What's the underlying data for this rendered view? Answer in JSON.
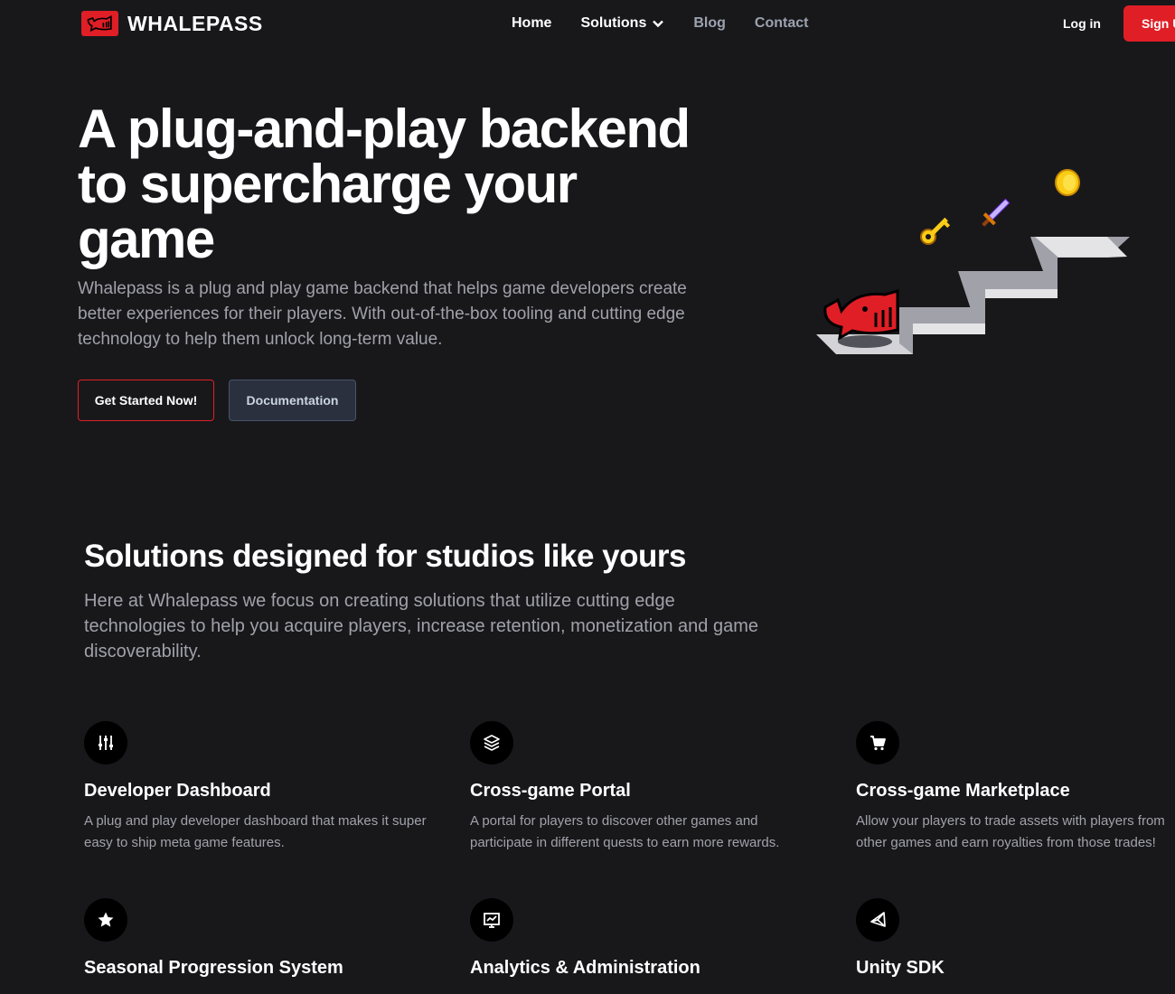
{
  "brand": {
    "name": "WHALEPASS",
    "accent": "#e01e26"
  },
  "nav": {
    "links": [
      {
        "label": "Home"
      },
      {
        "label": "Solutions"
      },
      {
        "label": "Blog"
      },
      {
        "label": "Contact"
      }
    ],
    "login_label": "Log in",
    "signup_label": "Sign Up"
  },
  "hero": {
    "title": "A plug-and-play backend to supercharge your game",
    "description": "Whalepass is a plug and play game backend that helps game developers create better experiences for their players. With out-of-the-box tooling and cutting edge technology to help them unlock long-term value.",
    "primary_cta": "Get Started Now!",
    "secondary_cta": "Documentation"
  },
  "solutions": {
    "title": "Solutions designed for studios like yours",
    "description": "Here at Whalepass we focus on creating solutions that utilize cutting edge technologies to help you acquire players, increase retention, monetization and game discoverability.",
    "features": [
      {
        "icon": "sliders-icon",
        "title": "Developer Dashboard",
        "desc": "A plug and play developer dashboard that makes it super easy to ship meta game features."
      },
      {
        "icon": "layers-icon",
        "title": "Cross-game Portal",
        "desc": "A portal for players to discover other games and participate in different quests to earn more rewards."
      },
      {
        "icon": "cart-icon",
        "title": "Cross-game Marketplace",
        "desc": "Allow your players to trade assets with players from other games and earn royalties from those trades!"
      },
      {
        "icon": "star-icon",
        "title": "Seasonal Progression System",
        "desc": ""
      },
      {
        "icon": "chart-icon",
        "title": "Analytics & Administration",
        "desc": ""
      },
      {
        "icon": "unity-icon",
        "title": "Unity SDK",
        "desc": ""
      }
    ]
  }
}
